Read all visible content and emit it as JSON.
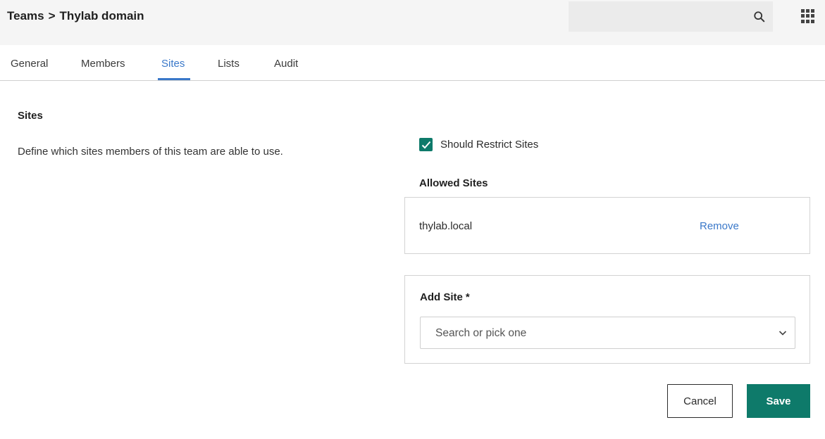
{
  "header": {
    "breadcrumb": [
      "Teams",
      "Thylab domain"
    ],
    "breadcrumb_separator": ">",
    "search": {
      "placeholder": "",
      "value": "",
      "icon": "search-icon"
    },
    "apps_icon": "grid-apps-icon"
  },
  "tabs": [
    {
      "label": "General",
      "active": false
    },
    {
      "label": "Members",
      "active": false
    },
    {
      "label": "Sites",
      "active": true
    },
    {
      "label": "Lists",
      "active": false
    },
    {
      "label": "Audit",
      "active": false
    }
  ],
  "section": {
    "title": "Sites",
    "description": "Define which sites members of this team are able to use."
  },
  "restrict": {
    "label": "Should Restrict Sites",
    "checked": true
  },
  "allowed_sites": {
    "title": "Allowed Sites",
    "items": [
      {
        "name": "thylab.local",
        "action": "Remove"
      }
    ]
  },
  "add_site": {
    "label": "Add Site",
    "required_marker": "*",
    "placeholder": "Search or pick one"
  },
  "actions": {
    "cancel": "Cancel",
    "save": "Save"
  },
  "colors": {
    "accent": "#3a78c9",
    "primary": "#0e7a6a",
    "header_bg": "#f5f5f5"
  }
}
